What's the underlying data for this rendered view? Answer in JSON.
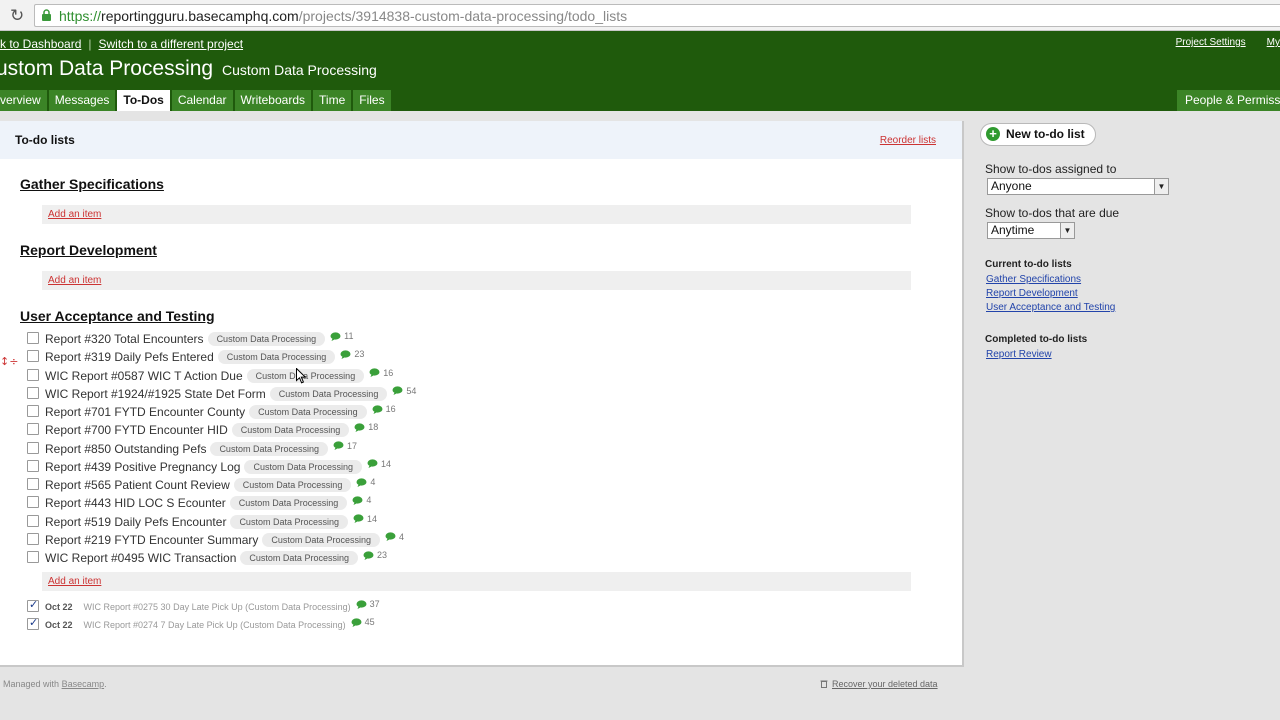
{
  "browser": {
    "url_scheme": "https://",
    "url_host": "reportingguru.basecamphq.com",
    "url_path": "/projects/3914838-custom-data-processing/todo_lists"
  },
  "header": {
    "back_link": "k to Dashboard",
    "switch_link": "Switch to a different project",
    "sep": "|",
    "project_settings": "Project Settings",
    "my_link": "My",
    "project_name": "ustom Data Processing",
    "project_sub": "Custom Data Processing",
    "tabs": [
      "verview",
      "Messages",
      "To-Dos",
      "Calendar",
      "Writeboards",
      "Time",
      "Files"
    ],
    "right_tab": "People & Permiss"
  },
  "main": {
    "title": "To-do lists",
    "reorder": "Reorder lists",
    "add_item": "Add an item",
    "lists": [
      {
        "title": "Gather Specifications"
      },
      {
        "title": "Report Development"
      },
      {
        "title": "User Acceptance and Testing"
      }
    ],
    "todos": [
      {
        "text": "Report #320 Total Encounters",
        "tag": "Custom Data Processing",
        "comments": "11"
      },
      {
        "text": "Report #319 Daily Pefs Entered",
        "tag": "Custom Data Processing",
        "comments": "23"
      },
      {
        "text": "WIC Report #0587 WIC T Action Due",
        "tag": "Custom Data Processing",
        "comments": "16"
      },
      {
        "text": "WIC Report #1924/#1925 State Det Form",
        "tag": "Custom Data Processing",
        "comments": "54"
      },
      {
        "text": "Report #701 FYTD Encounter County",
        "tag": "Custom Data Processing",
        "comments": "16"
      },
      {
        "text": "Report #700 FYTD Encounter HID",
        "tag": "Custom Data Processing",
        "comments": "18"
      },
      {
        "text": "Report #850 Outstanding Pefs",
        "tag": "Custom Data Processing",
        "comments": "17"
      },
      {
        "text": "Report #439 Positive Pregnancy Log",
        "tag": "Custom Data Processing",
        "comments": "14"
      },
      {
        "text": "Report #565 Patient Count Review",
        "tag": "Custom Data Processing",
        "comments": "4"
      },
      {
        "text": "Report #443 HID LOC S Ecounter",
        "tag": "Custom Data Processing",
        "comments": "4"
      },
      {
        "text": "Report #519 Daily Pefs Encounter",
        "tag": "Custom Data Processing",
        "comments": "14"
      },
      {
        "text": "Report #219 FYTD Encounter Summary",
        "tag": "Custom Data Processing",
        "comments": "4"
      },
      {
        "text": "WIC Report #0495 WIC Transaction",
        "tag": "Custom Data Processing",
        "comments": "23"
      }
    ],
    "completed": [
      {
        "date": "Oct 22",
        "text": "WIC Report #0275 30 Day Late Pick Up (Custom Data Processing)",
        "comments": "37"
      },
      {
        "date": "Oct 22",
        "text": "WIC Report #0274 7 Day Late Pick Up (Custom Data Processing)",
        "comments": "45"
      }
    ]
  },
  "sidebar": {
    "new_list": "New to-do list",
    "assigned_label": "Show to-dos assigned to",
    "assigned_value": "Anyone",
    "due_label": "Show to-dos that are due",
    "due_value": "Anytime",
    "current_head": "Current to-do lists",
    "current_lists": [
      "Gather Specifications",
      "Report Development",
      "User Acceptance and Testing"
    ],
    "completed_head": "Completed to-do lists",
    "completed_lists": [
      "Report Review"
    ]
  },
  "footer": {
    "managed": "Managed with",
    "basecamp": "Basecamp",
    "managed_dot": ".",
    "recover": "Recover your deleted data"
  },
  "colors": {
    "header_green": "#1f5a0c",
    "tab_green": "#3b8426",
    "link_red": "#cc3333",
    "link_blue": "#2244aa"
  },
  "icons": [
    "reload-icon",
    "lock-icon",
    "plus-icon",
    "comment-icon",
    "trash-icon",
    "drag-handle-icon"
  ]
}
